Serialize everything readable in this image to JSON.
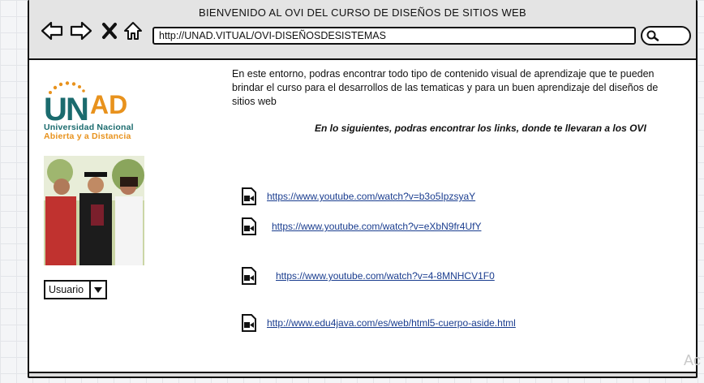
{
  "window": {
    "title": "BIENVENIDO AL OVI DEL CURSO DE DISEÑOS DE SITIOS WEB",
    "url": "http://UNAD.VITUAL/OVI-DISEÑOSDESISTEMAS"
  },
  "toolbar": {
    "icons": [
      "back-arrow-icon",
      "forward-arrow-icon",
      "close-icon",
      "home-icon",
      "search-icon"
    ]
  },
  "logo": {
    "name": "UNAD",
    "line1": "Universidad Nacional",
    "line2": "Abierta y a Distancia",
    "colors": {
      "teal": "#1b6b6e",
      "orange": "#e8921d"
    }
  },
  "user_select": {
    "selected": "Usuario"
  },
  "content": {
    "intro": "En este entorno, podras encontrar todo tipo de contenido visual de aprendizaje que te pueden brindar el curso para el desarrollos de las tematicas y para un buen aprendizaje del diseños de sitios web",
    "subtitle": "En lo siguientes, podras encontrar los links, donde te llevaran a los OVI"
  },
  "links": [
    {
      "url": "https://www.youtube.com/watch?v=b3o5IpzsyaY",
      "icon": "video-file-icon"
    },
    {
      "url": "https://www.youtube.com/watch?v=eXbN9fr4UfY",
      "icon": "video-file-icon"
    },
    {
      "url": "https://www.youtube.com/watch?v=4-8MNHCV1F0",
      "icon": "video-file-icon"
    },
    {
      "url": "http://www.edu4java.com/es/web/html5-cuerpo-aside.html",
      "icon": "video-file-icon"
    }
  ],
  "watermark": "Ac"
}
